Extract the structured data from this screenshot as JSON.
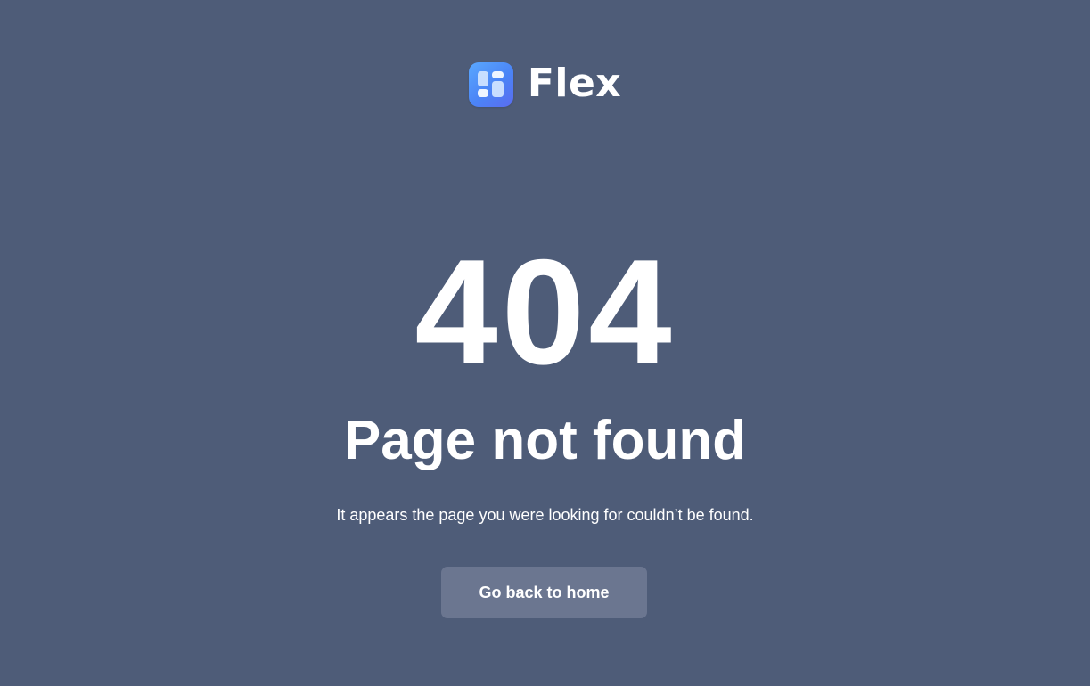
{
  "brand": {
    "name": "Flex",
    "icon": "flex-logo-icon"
  },
  "error": {
    "code": "404",
    "title": "Page not found",
    "message": "It appears the page you were looking for couldn’t be found."
  },
  "actions": {
    "home_label": "Go back to home"
  },
  "colors": {
    "background": "#4e5c78",
    "button": "#6b7690",
    "text": "#ffffff",
    "logo_accent": "#4b84f6"
  }
}
